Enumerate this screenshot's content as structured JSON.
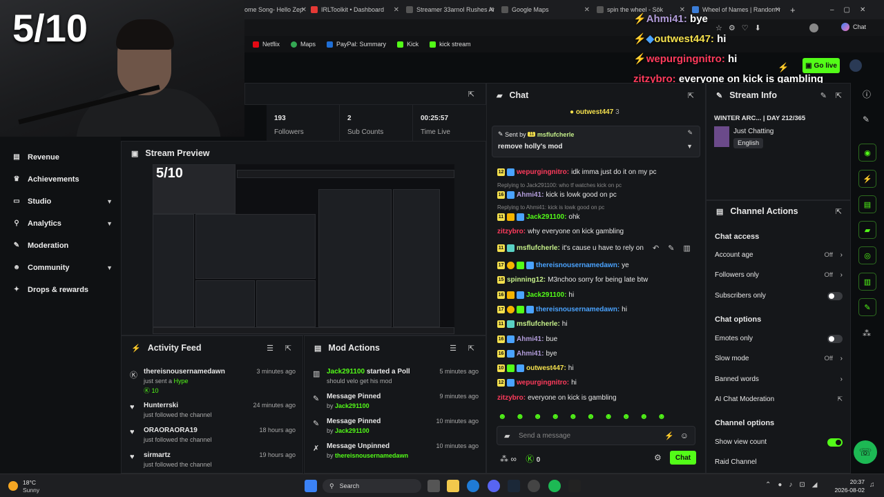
{
  "browser": {
    "tabs": [
      {
        "label": "ome Song- Hello Zep",
        "color": "#ff2b2b"
      },
      {
        "label": "IRLToolkit • Dashboard",
        "color": "#e53935"
      },
      {
        "label": "Streamer 33arnol Rushes An",
        "color": "#555"
      },
      {
        "label": "Google Maps",
        "color": "#555"
      },
      {
        "label": "spin the wheel - Sök",
        "color": "#555"
      },
      {
        "label": "Wheel of Names | Random n",
        "color": "#3b7dd8"
      }
    ],
    "chat_label": "Chat",
    "bookmarks": [
      "Netflix",
      "Maps",
      "PayPal: Summary",
      "Kick",
      "kick stream"
    ]
  },
  "webcam": {
    "score": "5/10"
  },
  "overlay_chat": [
    {
      "user": "Ahmi41:",
      "msg": "bye",
      "color": "#b39ddb"
    },
    {
      "user": "outwest447:",
      "msg": "hi",
      "color": "#f4e04d"
    },
    {
      "user": "wepurgingnitro:",
      "msg": "hi",
      "color": "#ff3b5c"
    },
    {
      "user": "zitzybro:",
      "msg": "everyone on kick is gambling",
      "color": "#ff3b5c"
    }
  ],
  "go_live": "Go live",
  "stats": [
    {
      "value": "193",
      "label": "Followers"
    },
    {
      "value": "2",
      "label": "Sub Counts"
    },
    {
      "value": "00:25:57",
      "label": "Time Live"
    }
  ],
  "sidebar": {
    "items": [
      {
        "label": "Revenue",
        "icon": "list-icon",
        "chevron": false
      },
      {
        "label": "Achievements",
        "icon": "trophy-icon",
        "chevron": false
      },
      {
        "label": "Studio",
        "icon": "studio-icon",
        "chevron": true
      },
      {
        "label": "Analytics",
        "icon": "analytics-icon",
        "chevron": true
      },
      {
        "label": "Moderation",
        "icon": "wrench-icon",
        "chevron": false
      },
      {
        "label": "Community",
        "icon": "community-icon",
        "chevron": true
      },
      {
        "label": "Drops & rewards",
        "icon": "gift-icon",
        "chevron": false
      }
    ]
  },
  "preview": {
    "title": "Stream Preview",
    "score": "5/10"
  },
  "activity_feed": {
    "title": "Activity Feed",
    "items": [
      {
        "name": "thereisnousernamedawn",
        "sub": "just sent a",
        "extra": "Hype",
        "count": "10",
        "time": "3 minutes ago",
        "icon": "kick-icon"
      },
      {
        "name": "Hunterrski",
        "sub": "just followed the channel",
        "time": "24 minutes ago",
        "icon": "heart-icon"
      },
      {
        "name": "ORAORAORA19",
        "sub": "just followed the channel",
        "time": "18 hours ago",
        "icon": "heart-icon"
      },
      {
        "name": "sirmartz",
        "sub": "just followed the channel",
        "time": "19 hours ago",
        "icon": "heart-icon"
      }
    ]
  },
  "mod_actions": {
    "title": "Mod Actions",
    "items": [
      {
        "who": "Jack291100",
        "action": "started a Poll",
        "sub": "should velo get his mod",
        "time": "5 minutes ago",
        "icon": "poll-icon"
      },
      {
        "action": "Message Pinned",
        "by": "by",
        "who": "Jack291100",
        "time": "9 minutes ago",
        "icon": "pin-icon"
      },
      {
        "action": "Message Pinned",
        "by": "by",
        "who": "Jack291100",
        "time": "10 minutes ago",
        "icon": "pin-icon"
      },
      {
        "action": "Message Unpinned",
        "by": "by",
        "who": "thereisnousernamedawn",
        "time": "10 minutes ago",
        "icon": "unpin-icon"
      }
    ]
  },
  "chat": {
    "title": "Chat",
    "top_user": "outwest447",
    "top_count": "3",
    "pinned": {
      "sent_by": "Sent by",
      "level": "11",
      "user": "msflufcherle",
      "msg": "remove holly's mod"
    },
    "lines": [
      {
        "lvl": "12",
        "user": "wepurgingnitro:",
        "msg": "idk imma just do it on my pc",
        "color": "#ff3b5c"
      },
      {
        "reply": "Replying to Jack291100: who tf watches kick on pc"
      },
      {
        "lvl": "16",
        "user": "Ahmi41:",
        "msg": "kick is lowk good on pc",
        "color": "#b39ddb"
      },
      {
        "reply": "Replying to Ahmi41: kick is lowk good on pc"
      },
      {
        "lvl": "11",
        "user": "Jack291100:",
        "msg": "ohk",
        "color": "#53fc18"
      },
      {
        "lvl": "",
        "user": "zitzybro:",
        "msg": "why everyone on kick gambling",
        "color": "#ff3b5c"
      },
      {
        "lvl": "11",
        "user": "msflufcherle:",
        "msg": "it's cause u have to rely on",
        "color": "#c6f08a"
      },
      {
        "lvl": "17",
        "user": "thereisnousernamedawn:",
        "msg": "ye",
        "color": "#4aa3ff"
      },
      {
        "lvl": "15",
        "user": "spinning12:",
        "msg": "M3nchoo sorry for being late btw",
        "color": "#c6f08a"
      },
      {
        "lvl": "16",
        "user": "Jack291100:",
        "msg": "hi",
        "color": "#53fc18"
      },
      {
        "lvl": "17",
        "user": "thereisnousernamedawn:",
        "msg": "hi",
        "color": "#4aa3ff"
      },
      {
        "lvl": "11",
        "user": "msflufcherle:",
        "msg": "hi",
        "color": "#c6f08a"
      },
      {
        "lvl": "16",
        "user": "Ahmi41:",
        "msg": "bue",
        "color": "#b39ddb"
      },
      {
        "lvl": "16",
        "user": "Ahmi41:",
        "msg": "bye",
        "color": "#b39ddb"
      },
      {
        "lvl": "10",
        "user": "outwest447:",
        "msg": "hi",
        "color": "#f4e04d"
      },
      {
        "lvl": "12",
        "user": "wepurgingnitro:",
        "msg": "hi",
        "color": "#ff3b5c"
      },
      {
        "lvl": "",
        "user": "zitzybro:",
        "msg": "everyone on kick is gambling",
        "color": "#ff3b5c"
      }
    ],
    "placeholder": "Send a message",
    "infinity": "∞",
    "count": "0",
    "send": "Chat"
  },
  "stream_info": {
    "title": "Stream Info",
    "stream_title": "WINTER ARC... | DAY 212/365",
    "category": "Just Chatting",
    "language": "English"
  },
  "channel_actions": {
    "title": "Channel Actions",
    "chat_access": "Chat access",
    "account_age": {
      "label": "Account age",
      "value": "Off"
    },
    "followers_only": {
      "label": "Followers only",
      "value": "Off"
    },
    "subscribers_only": {
      "label": "Subscribers only",
      "on": false
    },
    "chat_options": "Chat options",
    "emotes_only": {
      "label": "Emotes only",
      "on": false
    },
    "slow_mode": {
      "label": "Slow mode",
      "value": "Off"
    },
    "banned_words": "Banned words",
    "ai_mod": "AI Chat Moderation",
    "channel_options": "Channel options",
    "show_view_count": {
      "label": "Show view count",
      "on": true
    },
    "raid": "Raid Channel"
  },
  "taskbar": {
    "weather_temp": "18°C",
    "weather_desc": "Sunny",
    "search": "Search",
    "time": "20:37",
    "date": "2026-08-02"
  }
}
